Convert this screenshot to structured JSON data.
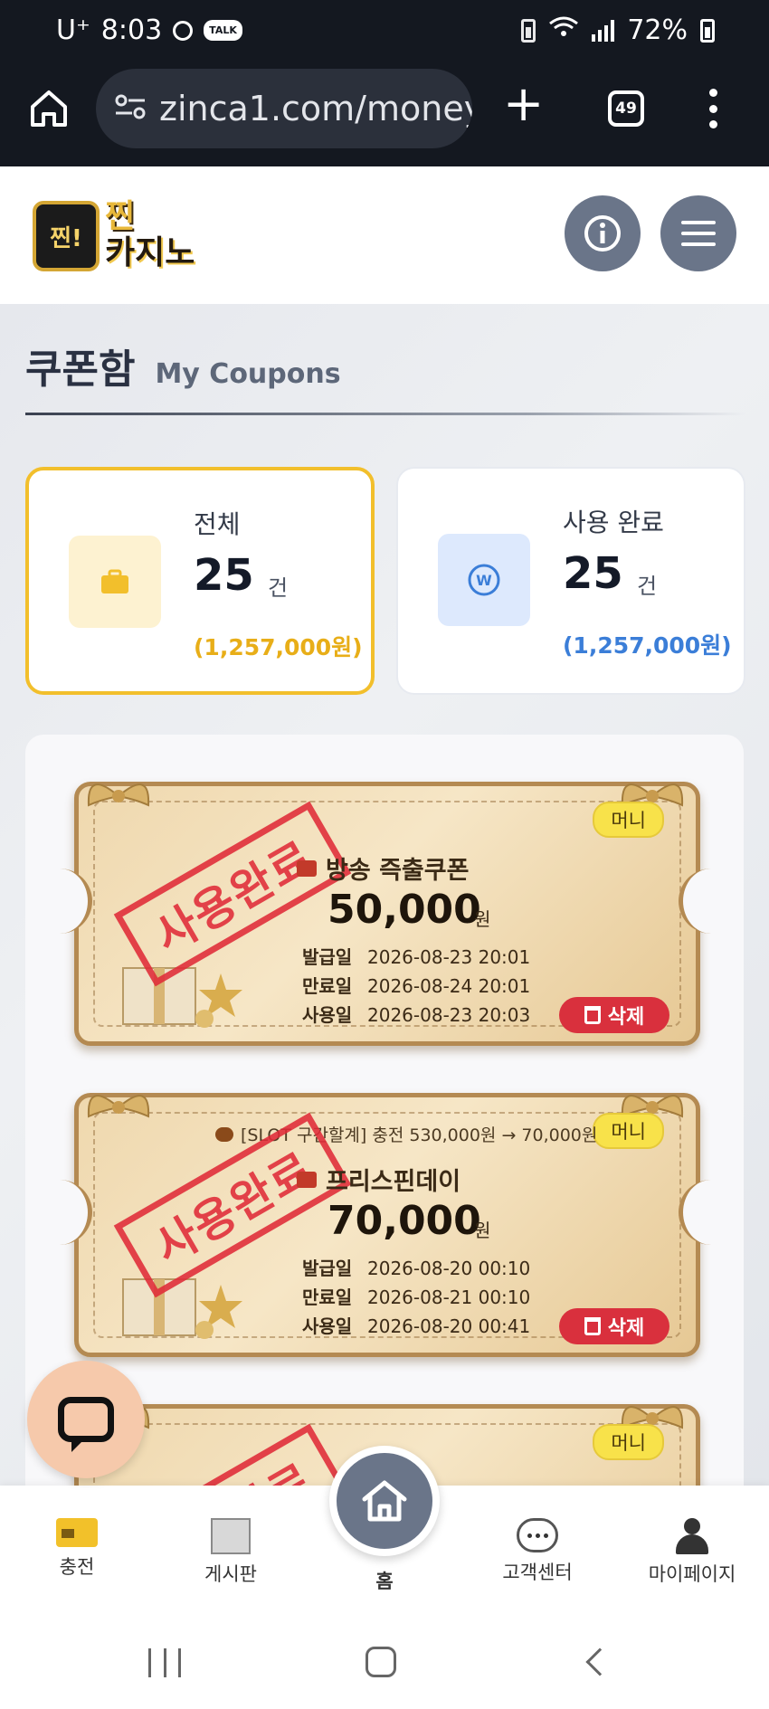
{
  "status_bar": {
    "carrier": "U⁺",
    "time": "8:03",
    "talk_badge": "TALK",
    "battery": "72%"
  },
  "browser": {
    "url": "zinca1.com/money",
    "tab_count": "49"
  },
  "header": {
    "logo_badge": "찐!",
    "logo_line1": "찐",
    "logo_line2": "카지노"
  },
  "page": {
    "title_ko": "쿠폰함",
    "title_en": "My Coupons"
  },
  "stats": {
    "total": {
      "label": "전체",
      "count": "25",
      "unit": "건",
      "amount": "(1,257,000원)"
    },
    "used": {
      "label": "사용 완료",
      "count": "25",
      "unit": "건",
      "amount": "(1,257,000원)"
    }
  },
  "coupons": [
    {
      "type": "머니",
      "stamp": "사용완료",
      "event_note": "",
      "name": "방송 즉출쿠폰",
      "amount": "50,000",
      "currency": "원",
      "issued_label": "발급일",
      "issued": "2026-08-23 20:01",
      "expires_label": "만료일",
      "expires": "2026-08-24 20:01",
      "used_label": "사용일",
      "used": "2026-08-23 20:03",
      "delete_label": "삭제"
    },
    {
      "type": "머니",
      "stamp": "사용완료",
      "event_note": "[SLOT 구간할계] 충전 530,000원 → 70,000원",
      "name": "프리스핀데이",
      "amount": "70,000",
      "currency": "원",
      "issued_label": "발급일",
      "issued": "2026-08-20 00:10",
      "expires_label": "만료일",
      "expires": "2026-08-21 00:10",
      "used_label": "사용일",
      "used": "2026-08-20 00:41",
      "delete_label": "삭제"
    },
    {
      "type": "머니",
      "stamp": "사용완료"
    }
  ],
  "bottom_nav": {
    "charge": "충전",
    "board": "게시판",
    "home": "홈",
    "support": "고객센터",
    "mypage": "마이페이지"
  },
  "colors": {
    "accent_yellow": "#f2bf2c",
    "accent_blue": "#3b7ed8",
    "danger_red": "#d9303d",
    "header_button": "#6a7589"
  }
}
